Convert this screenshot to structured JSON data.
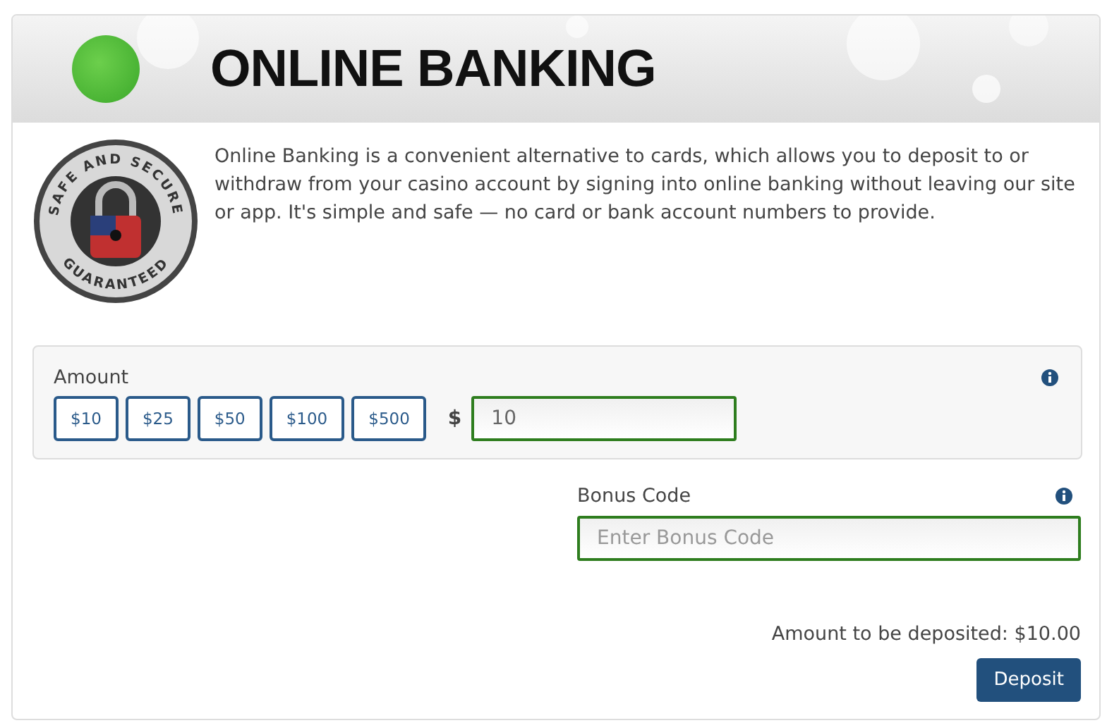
{
  "header": {
    "title": "ONLINE BANKING"
  },
  "badge": {
    "top_text": "SAFE AND SECURE",
    "bottom_text": "GUARANTEED"
  },
  "description": "Online Banking is a convenient alternative to cards, which allows you to deposit to or withdraw from your casino account by signing into online banking without leaving our site or app. It's simple and safe — no card or bank account numbers to provide.",
  "amount": {
    "label": "Amount",
    "presets": [
      "$10",
      "$25",
      "$50",
      "$100",
      "$500"
    ],
    "currency": "$",
    "value": "10"
  },
  "bonus_code": {
    "label": "Bonus Code",
    "placeholder": "Enter Bonus Code"
  },
  "summary": "Amount to be deposited: $10.00",
  "deposit_button": "Deposit"
}
